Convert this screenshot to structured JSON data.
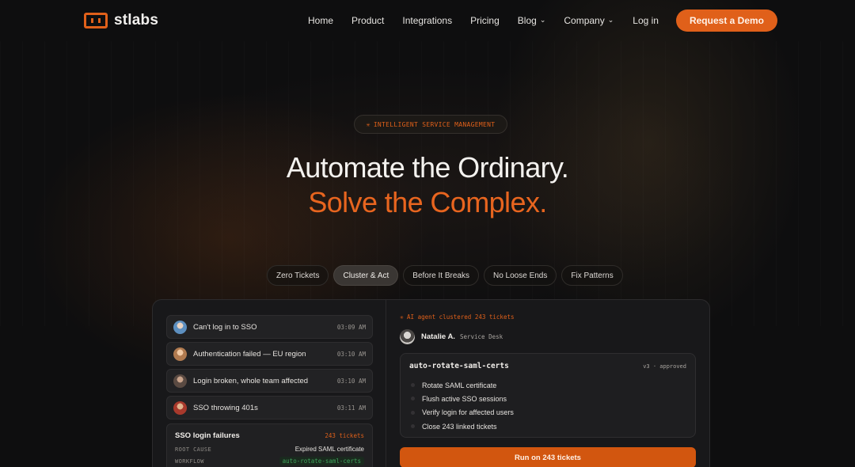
{
  "nav": {
    "logo_text": "stlabs",
    "links": [
      "Home",
      "Product",
      "Integrations",
      "Pricing",
      "Blog",
      "Company"
    ],
    "login": "Log in",
    "cta": "Request a Demo"
  },
  "hero": {
    "badge": "INTELLIGENT SERVICE MANAGEMENT",
    "badge_icon": "✳",
    "headline_1": "Automate the Ordinary.",
    "headline_2": "Solve the Complex."
  },
  "tabs": [
    {
      "label": "Zero Tickets",
      "active": false
    },
    {
      "label": "Cluster & Act",
      "active": true
    },
    {
      "label": "Before It Breaks",
      "active": false
    },
    {
      "label": "No Loose Ends",
      "active": false
    },
    {
      "label": "Fix Patterns",
      "active": false
    }
  ],
  "tickets": [
    {
      "title": "Can't log in to SSO",
      "time": "03:09 AM",
      "avatar_color": "#6aa9d8"
    },
    {
      "title": "Authentication failed — EU region",
      "time": "03:10 AM",
      "avatar_color": "#d6a37a"
    },
    {
      "title": "Login broken, whole team affected",
      "time": "03:10 AM",
      "avatar_color": "#8a7366"
    },
    {
      "title": "SSO throwing 401s",
      "time": "03:11 AM",
      "avatar_color": "#c0503f"
    }
  ],
  "cluster": {
    "title": "SSO login failures",
    "count": "243 tickets",
    "root_cause_label": "ROOT CAUSE",
    "root_cause": "Expired SAML certificate",
    "workflow_label": "WORKFLOW",
    "workflow": "auto-rotate-saml-certs"
  },
  "agent": {
    "line": "✳ AI agent clustered 243 tickets",
    "user_name": "Natalie A.",
    "user_role": "Service Desk"
  },
  "workflow_card": {
    "name": "auto-rotate-saml-certs",
    "version": "v3 · approved",
    "steps": [
      "Rotate SAML certificate",
      "Flush active SSO sessions",
      "Verify login for affected users",
      "Close 243 linked tickets"
    ],
    "run_button": "Run on 243 tickets"
  },
  "colors": {
    "accent": "#e0601a",
    "background": "#0e0e0f",
    "workflow_green": "#3fa35c"
  }
}
